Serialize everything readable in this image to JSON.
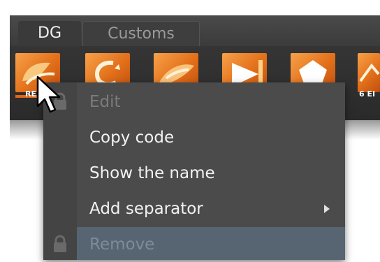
{
  "tabs": [
    {
      "label": "DG",
      "active": true
    },
    {
      "label": "Customs",
      "active": false
    }
  ],
  "shelf": {
    "icons": [
      {
        "name": "re-shape-icon",
        "label": "RE"
      },
      {
        "name": "curve-arc-icon",
        "label": ""
      },
      {
        "name": "twist-shape-icon",
        "label": ""
      },
      {
        "name": "triangle-flag-icon",
        "label": ""
      },
      {
        "name": "pentagon-icon",
        "label": ""
      },
      {
        "name": "partial-shape-icon",
        "label": "6 EI"
      }
    ],
    "accent_color": "#e3701a"
  },
  "context_menu": {
    "items": [
      {
        "label": "Edit",
        "enabled": false,
        "locked": true
      },
      {
        "label": "Copy code",
        "enabled": true
      },
      {
        "label": "Show the name",
        "enabled": true
      },
      {
        "label": "Add separator",
        "enabled": true,
        "submenu": true
      },
      {
        "label": "Remove",
        "enabled": false,
        "highlighted": true,
        "locked": true
      }
    ],
    "highlight_color": "#566571"
  },
  "cursor": "arrow-cursor-icon"
}
